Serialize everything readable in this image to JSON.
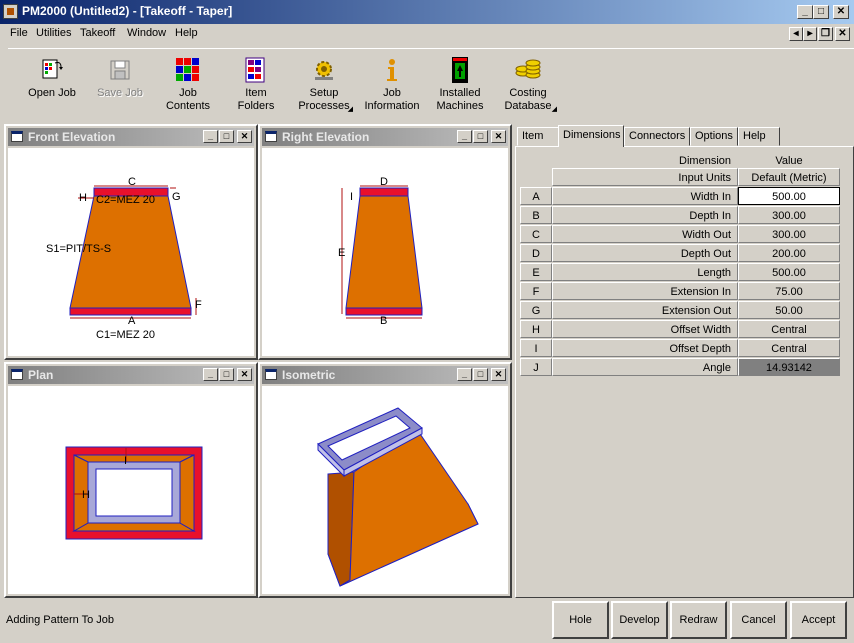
{
  "window": {
    "title": "PM2000 (Untitled2) - [Takeoff - Taper]"
  },
  "menu": [
    "File",
    "Utilities",
    "Takeoff",
    "Window",
    "Help"
  ],
  "toolbar": [
    {
      "label": "Open Job",
      "icon": "open-job-icon",
      "enabled": true
    },
    {
      "label": "Save Job",
      "icon": "save-job-icon",
      "enabled": false
    },
    {
      "label": "Job\nContents",
      "icon": "job-contents-icon",
      "enabled": true
    },
    {
      "label": "Item\nFolders",
      "icon": "item-folders-icon",
      "enabled": true
    },
    {
      "label": "Setup\nProcesses",
      "icon": "setup-processes-icon",
      "enabled": true,
      "dropdown": true
    },
    {
      "label": "Job\nInformation",
      "icon": "job-information-icon",
      "enabled": true
    },
    {
      "label": "Installed\nMachines",
      "icon": "installed-machines-icon",
      "enabled": true
    },
    {
      "label": "Costing\nDatabase",
      "icon": "costing-database-icon",
      "enabled": true,
      "dropdown": true
    }
  ],
  "views": {
    "front": {
      "title": "Front Elevation",
      "labels": {
        "c": "C",
        "h": "H",
        "g": "G",
        "c2": "C2=MEZ 20",
        "s1": "S1=PIT/TS-S",
        "f": "F",
        "a": "A",
        "c1": "C1=MEZ 20"
      }
    },
    "right": {
      "title": "Right Elevation",
      "labels": {
        "d": "D",
        "i": "I",
        "e": "E",
        "b": "B"
      }
    },
    "plan": {
      "title": "Plan",
      "labels": {
        "i": "I",
        "h": "H"
      }
    },
    "iso": {
      "title": "Isometric"
    }
  },
  "tabs": [
    "Item",
    "Dimensions",
    "Connectors",
    "Options",
    "Help"
  ],
  "active_tab": "Dimensions",
  "grid": {
    "header": {
      "name": "Dimension",
      "value": "Value"
    },
    "units": {
      "name": "Input Units",
      "value": "Default (Metric)"
    },
    "rows": [
      {
        "key": "A",
        "name": "Width In",
        "value": "500.00",
        "state": "edit"
      },
      {
        "key": "B",
        "name": "Depth In",
        "value": "300.00",
        "state": "normal"
      },
      {
        "key": "C",
        "name": "Width Out",
        "value": "300.00",
        "state": "normal"
      },
      {
        "key": "D",
        "name": "Depth Out",
        "value": "200.00",
        "state": "normal"
      },
      {
        "key": "E",
        "name": "Length",
        "value": "500.00",
        "state": "normal"
      },
      {
        "key": "F",
        "name": "Extension In",
        "value": "75.00",
        "state": "normal"
      },
      {
        "key": "G",
        "name": "Extension Out",
        "value": "50.00",
        "state": "normal"
      },
      {
        "key": "H",
        "name": "Offset Width",
        "value": "Central",
        "state": "normal"
      },
      {
        "key": "I",
        "name": "Offset Depth",
        "value": "Central",
        "state": "normal"
      },
      {
        "key": "J",
        "name": "Angle",
        "value": "14.93142",
        "state": "readonly"
      }
    ]
  },
  "status": {
    "text": "Adding Pattern To Job"
  },
  "actions": [
    "Hole",
    "Develop",
    "Redraw",
    "Cancel",
    "Accept"
  ],
  "colors": {
    "duct": "#dd7000",
    "duct_dark": "#b05000",
    "connector": "#e8102c",
    "outline": "#2020c0",
    "dim": "#b01010"
  }
}
